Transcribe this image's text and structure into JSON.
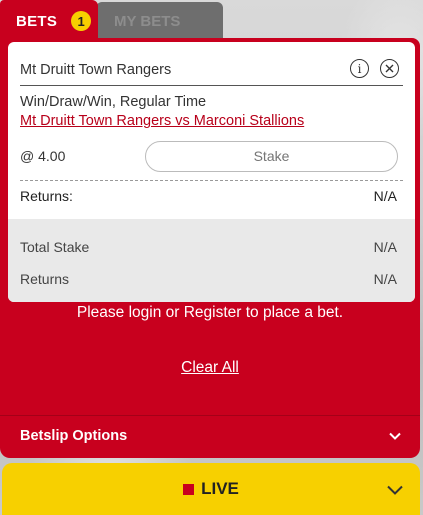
{
  "tabs": {
    "bets_label": "BETS",
    "bets_count": "1",
    "mybets_label": "MY BETS"
  },
  "bet": {
    "selection": "Mt Druitt Town Rangers",
    "market": "Win/Draw/Win, Regular Time",
    "event": "Mt Druitt Town Rangers vs Marconi Stallions",
    "odds": "@ 4.00",
    "stake_placeholder": "Stake",
    "returns_label": "Returns:",
    "returns_value": "N/A"
  },
  "summary": {
    "total_stake_label": "Total Stake",
    "total_stake_value": "N/A",
    "returns_label": "Returns",
    "returns_value": "N/A"
  },
  "login_message": "Please login or Register to place a bet.",
  "clear_all_label": "Clear All",
  "betslip_options_label": "Betslip Options",
  "live_label": "LIVE",
  "colors": {
    "brand_red": "#c8001e",
    "accent_yellow": "#f7d000",
    "tab_inactive": "#6e6e6e"
  },
  "icons": [
    "info-icon",
    "close-icon",
    "chevron-down-icon",
    "live-indicator-icon"
  ]
}
